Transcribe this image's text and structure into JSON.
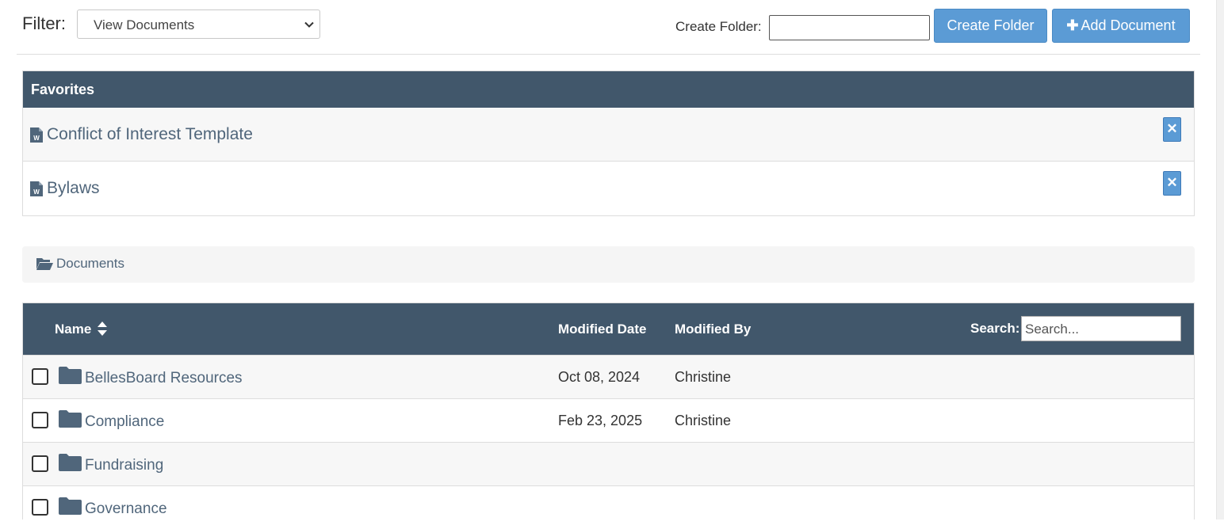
{
  "toolbar": {
    "filter_label": "Filter:",
    "filter_value": "View Documents",
    "create_folder_label": "Create Folder:",
    "create_folder_value": "",
    "create_folder_button": "Create Folder",
    "add_document_button": "Add Document",
    "add_document_icon": "plus-icon"
  },
  "favorites": {
    "header": "Favorites",
    "items": [
      {
        "title": "Conflict of Interest Template",
        "icon": "word-document-icon",
        "remove_label": "✕"
      },
      {
        "title": "Bylaws",
        "icon": "word-document-icon",
        "remove_label": "✕"
      }
    ]
  },
  "breadcrumb": {
    "icon": "folder-open-icon",
    "label": "Documents"
  },
  "table": {
    "headers": {
      "name": "Name",
      "modified_date": "Modified Date",
      "modified_by": "Modified By",
      "search_label": "Search:"
    },
    "search_placeholder": "Search...",
    "rows": [
      {
        "name": "BellesBoard Resources",
        "modified_date": "Oct 08, 2024",
        "modified_by": "Christine",
        "icon": "folder-icon"
      },
      {
        "name": "Compliance",
        "modified_date": "Feb 23, 2025",
        "modified_by": "Christine",
        "icon": "folder-icon"
      },
      {
        "name": "Fundraising",
        "modified_date": "",
        "modified_by": "",
        "icon": "folder-icon"
      },
      {
        "name": "Governance",
        "modified_date": "",
        "modified_by": "",
        "icon": "folder-icon"
      }
    ]
  },
  "colors": {
    "header_bg": "#41576b",
    "button_bg": "#5b9bd5",
    "link_text": "#50667b",
    "folder_icon": "#50667b"
  }
}
